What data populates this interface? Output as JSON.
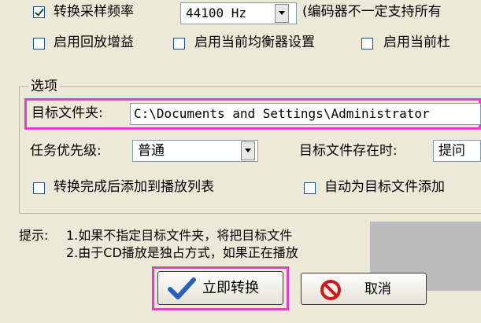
{
  "top": {
    "resample_label": "转换采样频率",
    "sample_rate": "44100 Hz",
    "encoder_note": "(编码器不一定支持所有",
    "replay_gain_label": "启用回放增益",
    "equalizer_label": "启用当前均衡器设置",
    "current_label": "启用当前杜"
  },
  "options": {
    "group_title": "选项",
    "target_folder_label": "目标文件夹:",
    "target_folder_value": "C:\\Documents and Settings\\Administrator",
    "priority_label": "任务优先级:",
    "priority_value": "普通",
    "exists_label": "目标文件存在时:",
    "exists_value": "提问",
    "add_to_playlist_label": "转换完成后添加到播放列表",
    "auto_add_label": "自动为目标文件添加"
  },
  "tips": {
    "prefix": "提示:",
    "line1": "1.如果不指定目标文件夹，将把目标文件",
    "line2": "2.由于CD播放是独占方式，如果正在播放"
  },
  "buttons": {
    "convert_label": "立即转换",
    "cancel_label": "取消"
  }
}
